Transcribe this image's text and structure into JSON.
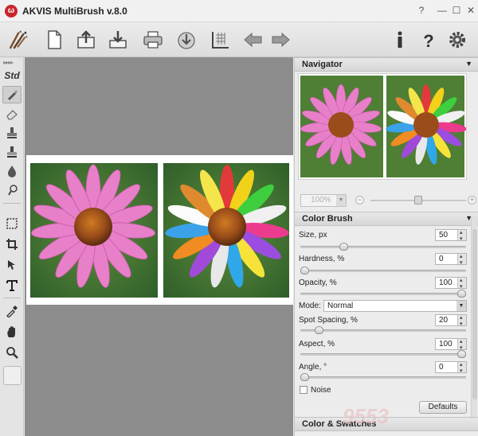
{
  "window": {
    "title": "AKVIS MultiBrush v.8.0",
    "controls": {
      "help": "?",
      "minimize": "—",
      "maximize": "☐",
      "close": "✕"
    }
  },
  "toolbar": {
    "items": [
      "brushes-logo-icon",
      "new-file-icon",
      "open-file-icon",
      "save-file-icon",
      "print-icon",
      "share-icon",
      "batch-grid-icon",
      "undo-arrow-icon",
      "redo-arrow-icon",
      "info-icon",
      "help-icon",
      "settings-gear-icon"
    ]
  },
  "tools": {
    "std_label": "Std",
    "items": [
      "brush-icon",
      "eraser-icon",
      "stamp-icon",
      "clone-icon",
      "blur-drop-icon",
      "smudge-icon",
      "selection-icon",
      "crop-icon",
      "move-icon",
      "text-icon",
      "eyedropper-icon",
      "hand-icon",
      "zoom-icon"
    ]
  },
  "navigator": {
    "title": "Navigator",
    "zoom_value": "100%",
    "zoom_minus": "−",
    "zoom_plus": "+",
    "zoom_level": 0.5
  },
  "color_brush": {
    "title": "Color Brush",
    "size_label": "Size, px",
    "size_value": "50",
    "size_fraction": 0.25,
    "hardness_label": "Hardness, %",
    "hardness_value": "0",
    "hardness_fraction": 0.0,
    "opacity_label": "Opacity, %",
    "opacity_value": "100",
    "opacity_fraction": 1.0,
    "mode_label": "Mode:",
    "mode_value": "Normal",
    "spacing_label": "Spot Spacing, %",
    "spacing_value": "20",
    "spacing_fraction": 0.09,
    "aspect_label": "Aspect, %",
    "aspect_value": "100",
    "aspect_fraction": 1.0,
    "angle_label": "Angle, °",
    "angle_value": "0",
    "angle_fraction": 0.0,
    "noise_label": "Noise",
    "defaults_label": "Defaults"
  },
  "swatches": {
    "title": "Color & Swatches"
  },
  "watermark": "9553"
}
